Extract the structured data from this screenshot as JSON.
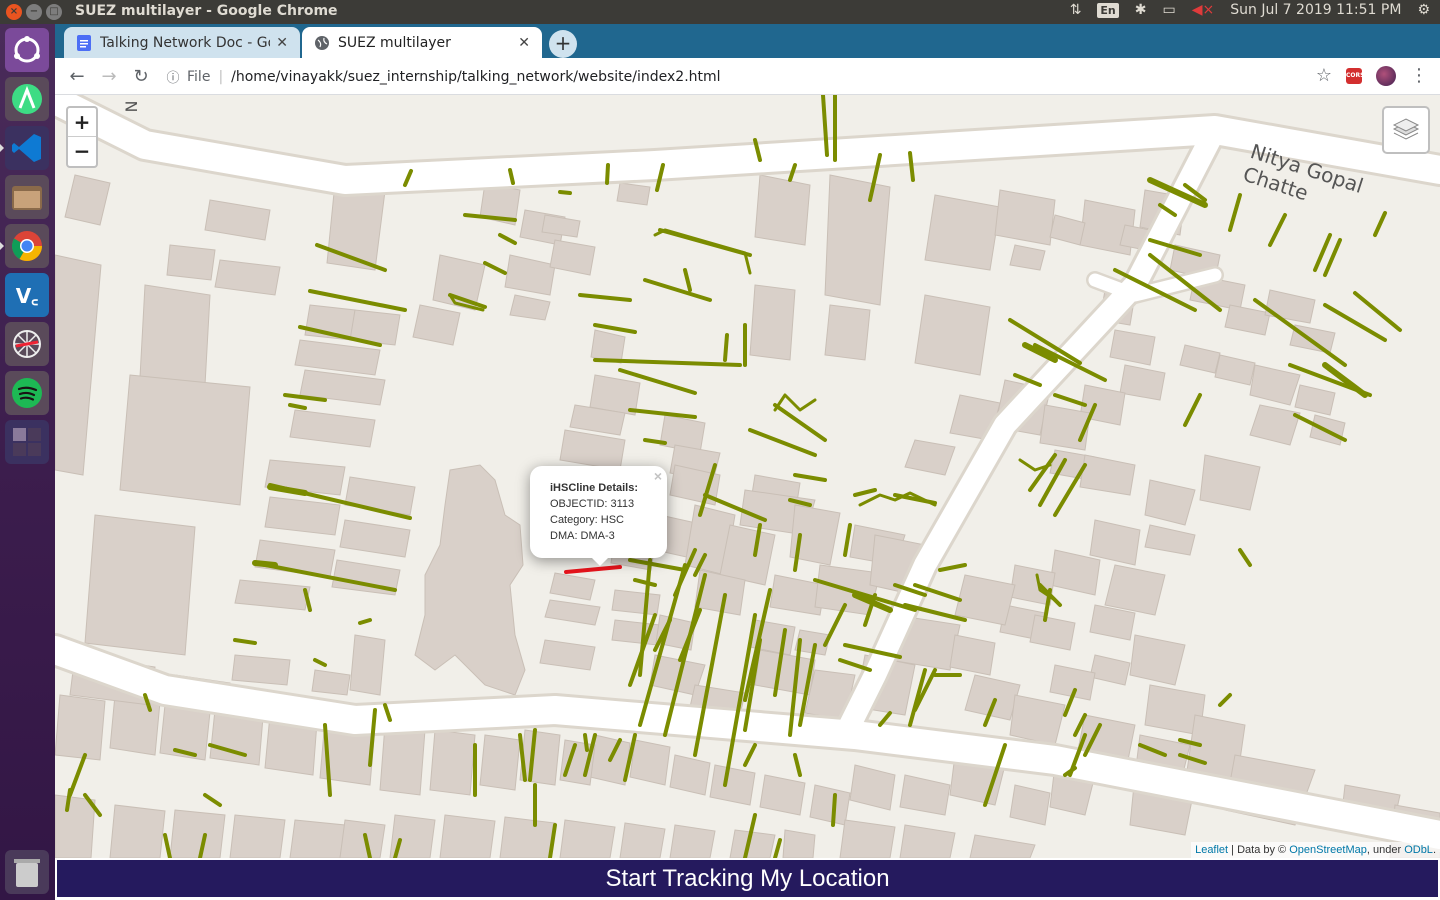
{
  "os_panel": {
    "window_title": "SUEZ multilayer - Google Chrome",
    "language": "En",
    "datetime": "Sun Jul  7 2019 11:51 PM"
  },
  "launcher": {
    "items": [
      {
        "name": "ubuntu-dash-icon"
      },
      {
        "name": "android-studio-icon"
      },
      {
        "name": "vscode-icon"
      },
      {
        "name": "file-manager-icon"
      },
      {
        "name": "chrome-icon"
      },
      {
        "name": "vnc-viewer-icon"
      },
      {
        "name": "network-tool-icon"
      },
      {
        "name": "spotify-icon"
      },
      {
        "name": "workspace-switcher-icon"
      },
      {
        "name": "trash-icon"
      }
    ]
  },
  "browser": {
    "tabs": [
      {
        "label": "Talking Network Doc - Goo",
        "icon": "docs-icon",
        "active": false
      },
      {
        "label": "SUEZ multilayer",
        "icon": "globe-icon",
        "active": true
      }
    ],
    "address": {
      "scheme_label": "File",
      "url": "/home/vinayakk/suez_internship/talking_network/website/index2.html"
    },
    "extension_label": "CORS"
  },
  "map": {
    "zoom_in_label": "+",
    "zoom_out_label": "−",
    "street_label_top_left": "N",
    "street_label_top_right": "Nitya Gopal Chatte",
    "popup": {
      "title": "iHSCline Details:",
      "lines": [
        "OBJECTID: 3113",
        "Category: HSC",
        "DMA: DMA-3"
      ],
      "close": "×"
    },
    "attribution": {
      "leaflet": "Leaflet",
      "data_by": " | Data by © ",
      "osm": "OpenStreetMap",
      "under": ", under ",
      "odbl": "ODbL",
      "end": "."
    },
    "colors": {
      "pipe": "#7b8c00",
      "selected_pipe": "#e8141c",
      "building": "#d9d0c9",
      "road": "#ffffff",
      "background": "#f1efe9"
    }
  },
  "track_button": {
    "label": "Start Tracking My Location",
    "color": "#251a5e"
  }
}
